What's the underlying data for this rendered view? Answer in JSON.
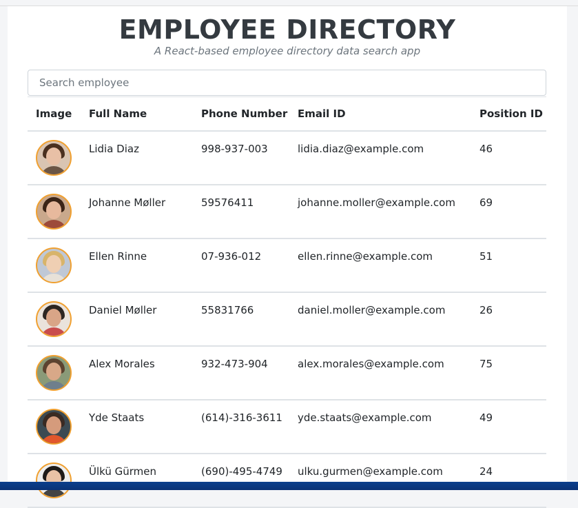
{
  "header": {
    "title": "EMPLOYEE DIRECTORY",
    "subtitle": "A React-based employee directory data search app"
  },
  "search": {
    "placeholder": "Search employee",
    "value": ""
  },
  "table": {
    "columns": [
      "Image",
      "Full Name",
      "Phone Number",
      "Email ID",
      "Position ID"
    ],
    "rows": [
      {
        "name": "Lidia Diaz",
        "phone": "998-937-003",
        "email": "lidia.diaz@example.com",
        "position": "46",
        "hair": "#4a3020",
        "skin": "#e8c0a6",
        "bg": "#d9c4b2",
        "shirt": "#6b5545"
      },
      {
        "name": "Johanne Møller",
        "phone": "59576411",
        "email": "johanne.moller@example.com",
        "position": "69",
        "hair": "#3b2417",
        "skin": "#e7b99d",
        "bg": "#c9a88c",
        "shirt": "#9c4a3a"
      },
      {
        "name": "Ellen Rinne",
        "phone": "07-936-012",
        "email": "ellen.rinne@example.com",
        "position": "51",
        "hair": "#d8b46a",
        "skin": "#efcfb3",
        "bg": "#bfc8d6",
        "shirt": "#e7e1d8"
      },
      {
        "name": "Daniel Møller",
        "phone": "55831766",
        "email": "daniel.moller@example.com",
        "position": "26",
        "hair": "#2d2622",
        "skin": "#d9a587",
        "bg": "#eae3dc",
        "shirt": "#c94c4c"
      },
      {
        "name": "Alex Morales",
        "phone": "932-473-904",
        "email": "alex.morales@example.com",
        "position": "75",
        "hair": "#5c4330",
        "skin": "#d8a888",
        "bg": "#8a9a78",
        "shirt": "#6f7f8c"
      },
      {
        "name": "Yde Staats",
        "phone": "(614)-316-3611",
        "email": "yde.staats@example.com",
        "position": "49",
        "hair": "#3a2a22",
        "skin": "#d59b7c",
        "bg": "#3c4a52",
        "shirt": "#e2572c"
      },
      {
        "name": "Ülkü Gürmen",
        "phone": "(690)-495-4749",
        "email": "ulku.gurmen@example.com",
        "position": "24",
        "hair": "#1e1a18",
        "skin": "#e9c2a6",
        "bg": "#eeeeee",
        "shirt": "#444444"
      }
    ]
  },
  "colors": {
    "avatar_border": "#f0a030",
    "title": "#343a40",
    "subtitle": "#6c757d",
    "taskbar": "#0b3f8c"
  }
}
